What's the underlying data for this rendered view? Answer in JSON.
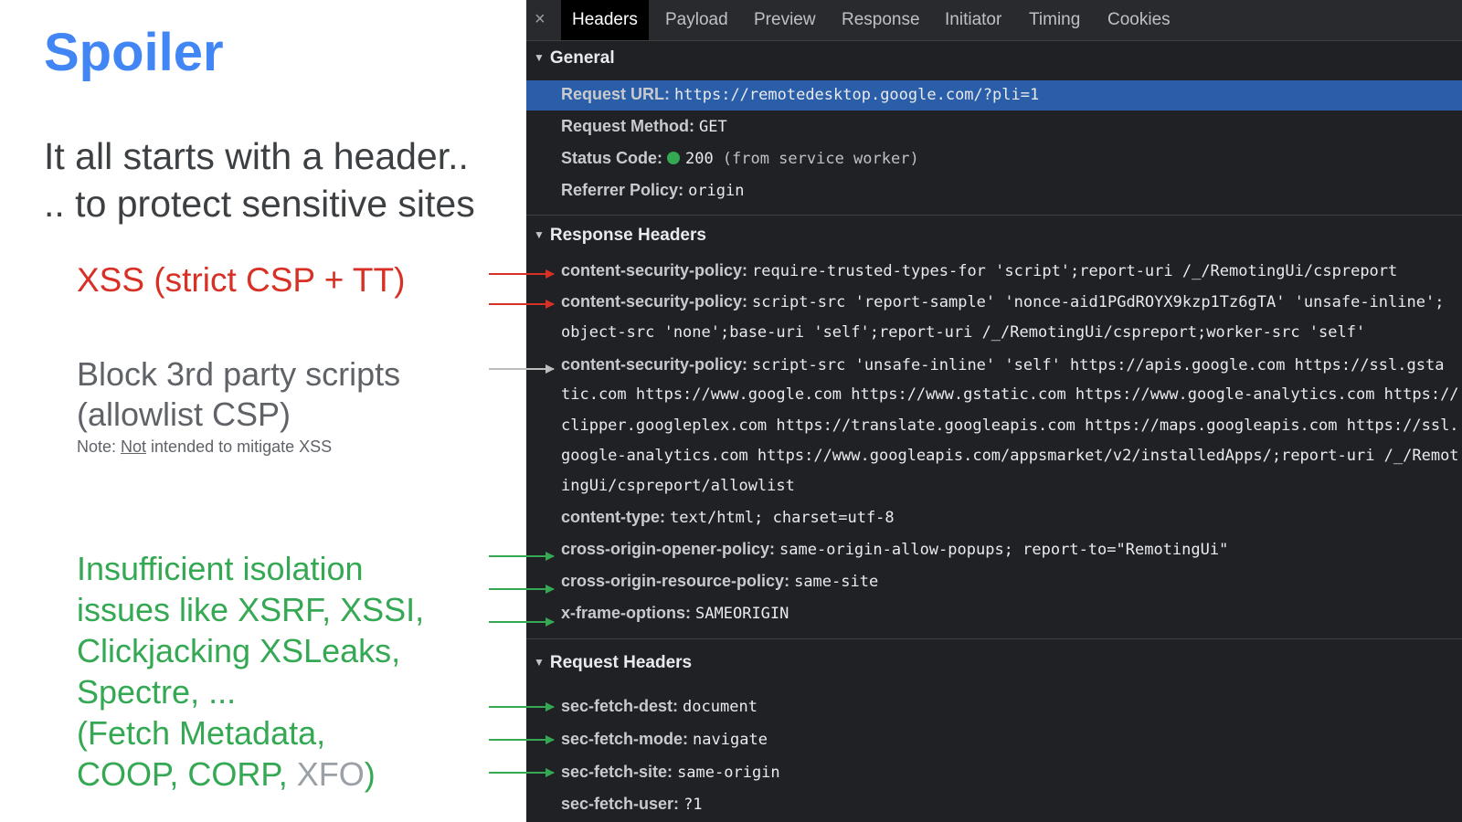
{
  "slide": {
    "title": "Spoiler",
    "subtitle_line1": "It all starts with a header..",
    "subtitle_line2": ".. to protect sensitive sites",
    "xss_point": "XSS (strict CSP + TT)",
    "block_line1": "Block 3rd party scripts",
    "block_line2": "(allowlist CSP)",
    "note_prefix": "Note: ",
    "note_underlined": "Not",
    "note_suffix": " intended to mitigate XSS",
    "isolation_lines": [
      "Insufficient isolation",
      "issues like XSRF, XSSI,",
      "Clickjacking XSLeaks,",
      "Spectre, ...",
      "(Fetch Metadata,"
    ],
    "isolation_last_line": "COOP, CORP, ",
    "isolation_xfo": "XFO",
    "isolation_close": ")"
  },
  "colors": {
    "title_blue": "#4285f4",
    "xss_red": "#d93025",
    "isolation_green": "#34a853",
    "block_grey": "#5f6368",
    "selected_row_blue": "#2b5ea8",
    "status_green": "#34a853"
  },
  "devtools": {
    "close_glyph": "×",
    "tabs": [
      "Headers",
      "Payload",
      "Preview",
      "Response",
      "Initiator",
      "Timing",
      "Cookies"
    ],
    "active_tab": "Headers",
    "general": {
      "title": "General",
      "request_url_label": "Request URL:",
      "request_url": "https://remotedesktop.google.com/?pli=1",
      "method_label": "Request Method:",
      "method": "GET",
      "status_label": "Status Code:",
      "status_code": "200",
      "status_note": "(from service worker)",
      "referrer_label": "Referrer Policy:",
      "referrer": "origin"
    },
    "response_headers": {
      "title": "Response Headers",
      "csp1_label": "content-security-policy:",
      "csp1_value": "require-trusted-types-for 'script';report-uri /_/RemotingUi/cspreport",
      "csp2_label": "content-security-policy:",
      "csp2_value": "script-src 'report-sample' 'nonce-aid1PGdROYX9kzp1Tz6gTA' 'unsafe-inline';",
      "csp2_cont": "object-src 'none';base-uri 'self';report-uri /_/RemotingUi/cspreport;worker-src 'self'",
      "csp3_label": "content-security-policy:",
      "csp3_value": "script-src 'unsafe-inline' 'self' https://apis.google.com https://ssl.gsta",
      "csp3_cont1": "tic.com https://www.google.com https://www.gstatic.com https://www.google-analytics.com https://",
      "csp3_cont2": "clipper.googleplex.com https://translate.googleapis.com https://maps.googleapis.com https://ssl.",
      "csp3_cont3": "google-analytics.com https://www.googleapis.com/appsmarket/v2/installedApps/;report-uri /_/Remot",
      "csp3_cont4": "ingUi/cspreport/allowlist",
      "ctype_label": "content-type:",
      "ctype_value": "text/html; charset=utf-8",
      "coop_label": "cross-origin-opener-policy:",
      "coop_value": "same-origin-allow-popups; report-to=\"RemotingUi\"",
      "corp_label": "cross-origin-resource-policy:",
      "corp_value": "same-site",
      "xfo_label": "x-frame-options:",
      "xfo_value": "SAMEORIGIN"
    },
    "request_headers": {
      "title": "Request Headers",
      "dest_label": "sec-fetch-dest:",
      "dest_value": "document",
      "mode_label": "sec-fetch-mode:",
      "mode_value": "navigate",
      "site_label": "sec-fetch-site:",
      "site_value": "same-origin",
      "user_label": "sec-fetch-user:",
      "user_value": "?1"
    }
  }
}
